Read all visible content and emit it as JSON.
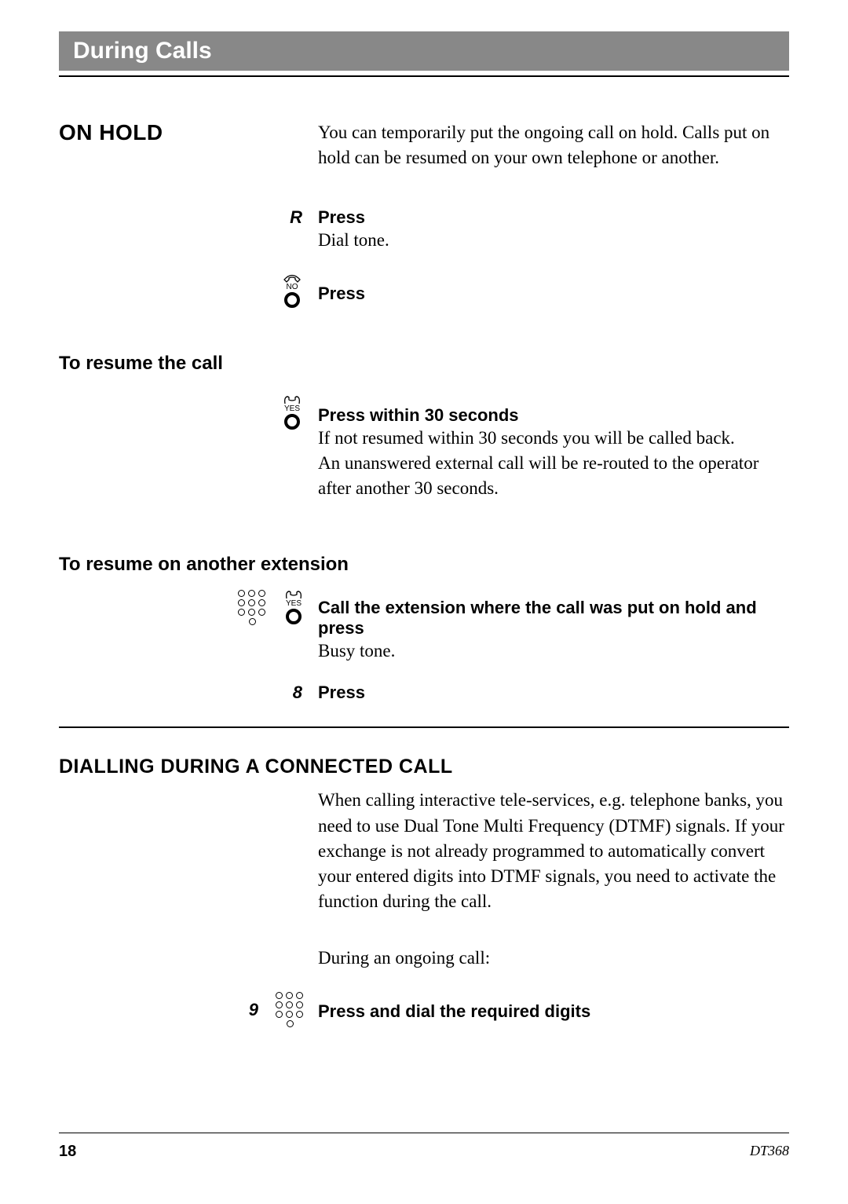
{
  "header": {
    "title": "During Calls"
  },
  "onhold": {
    "heading": "ON HOLD",
    "intro": "You can temporarily put the ongoing call on hold. Calls put on hold can be resumed on your own telephone or another.",
    "step1_key": "R",
    "step1_action": "Press",
    "step1_note": "Dial tone.",
    "step2_icon_label": "NO",
    "step2_action": "Press"
  },
  "resume": {
    "heading": "To resume the call",
    "icon_label": "YES",
    "action": "Press within 30 seconds",
    "note1": "If not resumed within 30 seconds you will be called back.",
    "note2": "An unanswered external call will be re-routed to the operator after another 30 seconds."
  },
  "resume_other": {
    "heading": "To resume on another extension",
    "icon_label": "YES",
    "action": "Call the extension where the call was put on hold and press",
    "note": "Busy tone.",
    "step2_digit": "8",
    "step2_action": "Press"
  },
  "dialling": {
    "heading": "DIALLING DURING A CONNECTED CALL",
    "intro": "When calling interactive tele-services, e.g. telephone banks, you need to use Dual Tone Multi Frequency (DTMF) signals. If your exchange is not already programmed to automatically convert your entered digits into DTMF signals, you need to activate the function during the call.",
    "context": "During an ongoing call:",
    "step_digit": "9",
    "step_action": "Press and dial the required digits"
  },
  "footer": {
    "page": "18",
    "model": "DT368"
  }
}
